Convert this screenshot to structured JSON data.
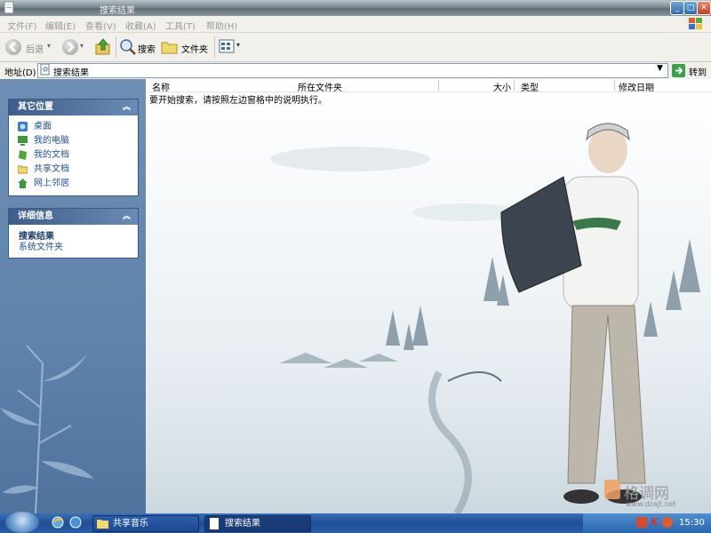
{
  "window": {
    "title": "搜索结果"
  },
  "menu": [
    "文件(F)",
    "编辑(E)",
    "查看(V)",
    "收藏(A)",
    "工具(T)",
    "帮助(H)"
  ],
  "toolbar": {
    "back": "后退",
    "search": "搜索",
    "folders": "文件夹"
  },
  "address": {
    "label": "地址(D)",
    "value": "搜索结果",
    "go": "转到"
  },
  "sidebar": {
    "places_title": "其它位置",
    "places": [
      "桌面",
      "我的电脑",
      "我的文档",
      "共享文档",
      "网上邻居"
    ],
    "details_title": "详细信息",
    "details_name": "搜索结果",
    "details_type": "系统文件夹"
  },
  "columns": [
    "名称",
    "所在文件夹",
    "大小",
    "类型",
    "修改日期"
  ],
  "main": {
    "hint": "要开始搜索，请按照左边窗格中的说明执行。"
  },
  "taskbar": {
    "items": [
      "共享音乐",
      "搜索结果"
    ],
    "clock": "15:30"
  },
  "watermark": {
    "brand": "格调网",
    "url": "www.dzajt.net"
  }
}
